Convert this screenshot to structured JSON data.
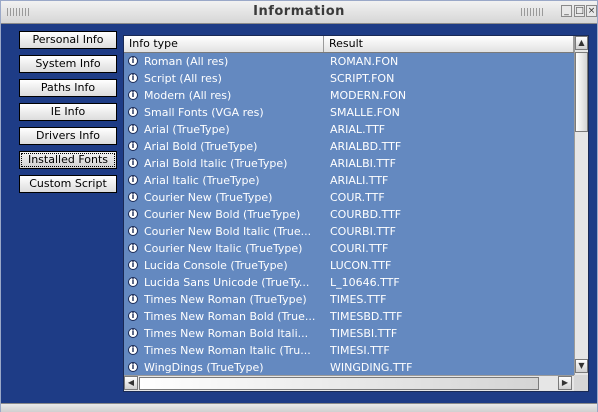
{
  "window": {
    "title": "Information"
  },
  "nav": {
    "buttons": [
      {
        "label": "Personal Info"
      },
      {
        "label": "System Info"
      },
      {
        "label": "Paths Info"
      },
      {
        "label": "IE Info"
      },
      {
        "label": "Drivers Info"
      },
      {
        "label": "Installed Fonts"
      },
      {
        "label": "Custom Script"
      }
    ],
    "active": "Installed Fonts"
  },
  "list": {
    "columns": [
      "Info type",
      "Result"
    ],
    "rows": [
      [
        "Roman (All res)",
        "ROMAN.FON"
      ],
      [
        "Script (All res)",
        "SCRIPT.FON"
      ],
      [
        "Modern (All res)",
        "MODERN.FON"
      ],
      [
        "Small Fonts (VGA res)",
        "SMALLE.FON"
      ],
      [
        "Arial (TrueType)",
        "ARIAL.TTF"
      ],
      [
        "Arial Bold (TrueType)",
        "ARIALBD.TTF"
      ],
      [
        "Arial Bold Italic (TrueType)",
        "ARIALBI.TTF"
      ],
      [
        "Arial Italic (TrueType)",
        "ARIALI.TTF"
      ],
      [
        "Courier New (TrueType)",
        "COUR.TTF"
      ],
      [
        "Courier New Bold (TrueType)",
        "COURBD.TTF"
      ],
      [
        "Courier New Bold Italic (True...",
        "COURBI.TTF"
      ],
      [
        "Courier New Italic (TrueType)",
        "COURI.TTF"
      ],
      [
        "Lucida Console (TrueType)",
        "LUCON.TTF"
      ],
      [
        "Lucida Sans Unicode (TrueTy...",
        "L_10646.TTF"
      ],
      [
        "Times New Roman (TrueType)",
        "TIMES.TTF"
      ],
      [
        "Times New Roman Bold (True...",
        "TIMESBD.TTF"
      ],
      [
        "Times New Roman Bold Itali...",
        "TIMESBI.TTF"
      ],
      [
        "Times New Roman Italic (Tru...",
        "TIMESI.TTF"
      ],
      [
        "WingDings (TrueType)",
        "WINGDING.TTF"
      ]
    ],
    "row_icon": "info-icon"
  },
  "colors": {
    "window_bg": "#1e3c86",
    "list_bg": "#6489c0",
    "text": "#ffffff"
  }
}
